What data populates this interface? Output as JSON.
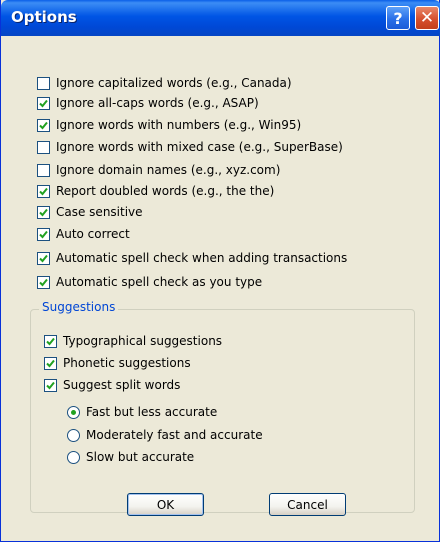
{
  "window": {
    "title": "Options",
    "help_glyph": "?",
    "close_glyph": "✕",
    "title_color": "#0055E5",
    "accent_check_color": "#21A121"
  },
  "options": [
    {
      "label": "Ignore capitalized words (e.g., Canada)",
      "checked": false
    },
    {
      "label": "Ignore all-caps words (e.g., ASAP)",
      "checked": true
    },
    {
      "label": "Ignore words with numbers (e.g., Win95)",
      "checked": true
    },
    {
      "label": "Ignore words with mixed case (e.g., SuperBase)",
      "checked": false
    },
    {
      "label": "Ignore domain names (e.g., xyz.com)",
      "checked": false
    },
    {
      "label": "Report doubled words (e.g., the the)",
      "checked": true
    },
    {
      "label": "Case sensitive",
      "checked": true
    },
    {
      "label": "Auto correct",
      "checked": true
    },
    {
      "label": "Automatic spell check when adding transactions",
      "checked": true
    },
    {
      "label": "Automatic spell check as you type",
      "checked": true
    }
  ],
  "suggestions": {
    "title": "Suggestions",
    "options": [
      {
        "label": "Typographical suggestions",
        "checked": true
      },
      {
        "label": "Phonetic suggestions",
        "checked": true
      },
      {
        "label": "Suggest split words",
        "checked": true
      }
    ],
    "speed": [
      {
        "label": "Fast but less accurate",
        "selected": true
      },
      {
        "label": "Moderately fast and accurate",
        "selected": false
      },
      {
        "label": "Slow but accurate",
        "selected": false
      }
    ]
  },
  "buttons": {
    "ok": "OK",
    "cancel": "Cancel"
  }
}
